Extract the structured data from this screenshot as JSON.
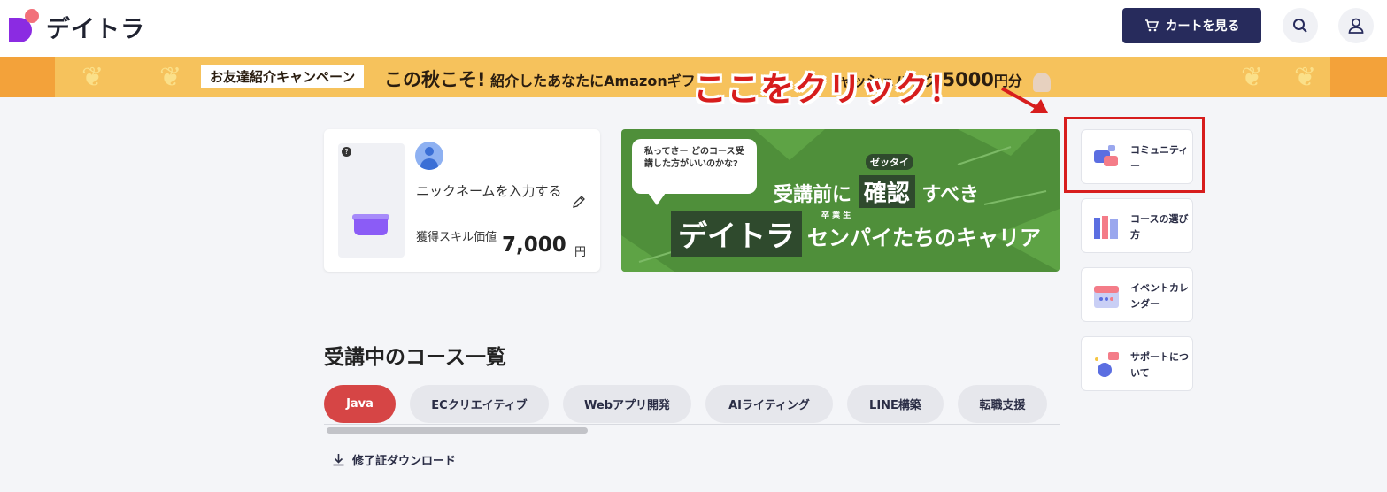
{
  "header": {
    "logo_text": "デイトラ",
    "cart_label": "カートを見る"
  },
  "banner": {
    "tag": "お友達紹介キャンペーン",
    "lead": "この秋こそ!",
    "text_a": "紹介したあなたにAmazonギフ",
    "text_b": "ャッシュバック",
    "amount": "5000",
    "unit": "円分"
  },
  "annotation": {
    "text": "ここをクリック！",
    "color": "#d71d1d"
  },
  "profile": {
    "help_badge": "?",
    "nickname": "ニックネームを入力する",
    "skill_label": "獲得スキル価値",
    "skill_value": "7,000",
    "skill_unit": "円"
  },
  "promo": {
    "bubble": "私ってさー どのコース受講した方がいいのかな?",
    "ruby1": "ゼッタイ",
    "line1_pre": "受講前に",
    "line1_box": "確認",
    "line1_post": "すべき",
    "box2": "デイトラ",
    "ruby2": "卒 業 生",
    "line2_post": "センパイたちのキャリア"
  },
  "side_menu": [
    {
      "label": "コミュニティー",
      "icon": "chat-icon"
    },
    {
      "label": "コースの選び方",
      "icon": "books-icon"
    },
    {
      "label": "イベントカレンダー",
      "icon": "calendar-icon"
    },
    {
      "label": "サポートについて",
      "icon": "support-icon"
    }
  ],
  "courses": {
    "title": "受講中のコース一覧",
    "tabs": [
      "Java",
      "ECクリエイティブ",
      "Webアプリ開発",
      "AIライティング",
      "LINE構築",
      "転職支援"
    ],
    "active_tab": "Java",
    "download_label": "修了証ダウンロード"
  },
  "colors": {
    "primary": "#272b5c",
    "accent_red": "#d64545",
    "banner": "#f6c25c",
    "promo_green": "#4f8f3a"
  }
}
